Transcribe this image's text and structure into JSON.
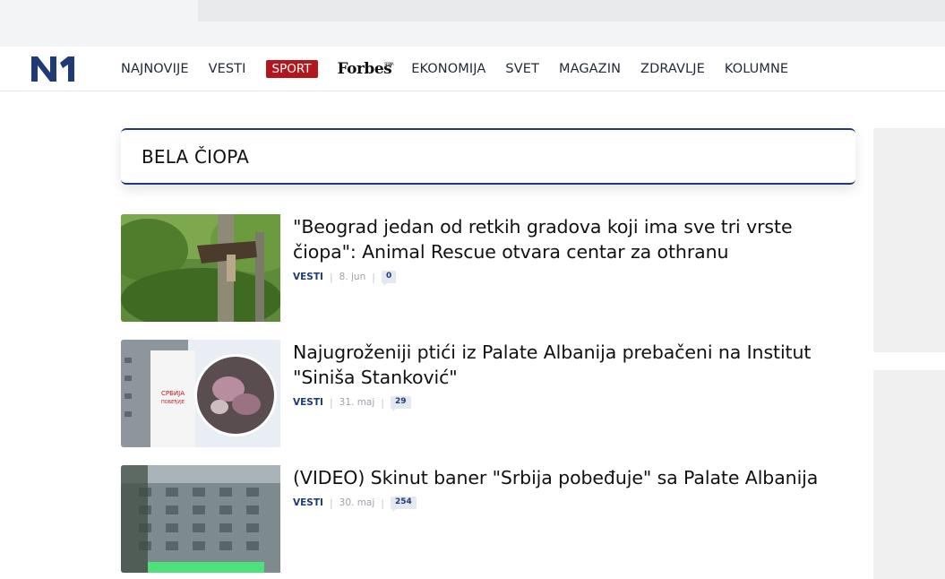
{
  "header": {
    "logo_text": "N1",
    "nav": {
      "najnovije": "NAJNOVIJE",
      "vesti": "VESTI",
      "sport": "SPORT",
      "forbes": "Forbes",
      "forbes_sup": "SRBIJA",
      "ekonomija": "EKONOMIJA",
      "svet": "SVET",
      "magazin": "MAGAZIN",
      "zdravlje": "ZDRAVLJE",
      "kolumne": "KOLUMNE"
    },
    "colors": {
      "brand": "#1f3a75",
      "sport": "#b3171e"
    }
  },
  "page": {
    "title": "BELA ČIOPA"
  },
  "articles": [
    {
      "headline": "\"Beograd jedan od retkih gradova koji ima sve tri vrste čiopa\": Animal Rescue otvara centar za othranu",
      "category": "VESTI",
      "date": "8. jun",
      "comments": "0"
    },
    {
      "headline": "Najugroženiji ptići iz Palate Albanija prebačeni na Institut \"Siniša Stanković\"",
      "category": "VESTI",
      "date": "31. maj",
      "comments": "29"
    },
    {
      "headline": "(VIDEO) Skinut baner \"Srbija pobeđuje\" sa Palate Albanija",
      "category": "VESTI",
      "date": "30. maj",
      "comments": "254"
    }
  ]
}
